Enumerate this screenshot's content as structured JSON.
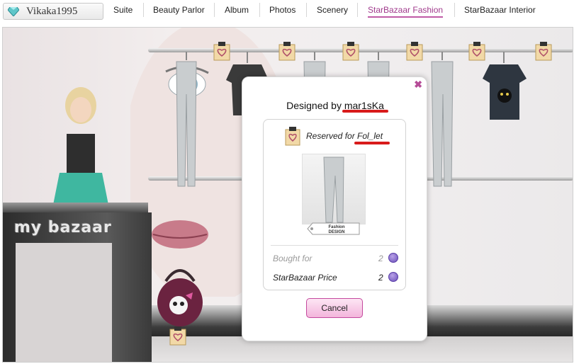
{
  "user": {
    "name": "Vikaka1995"
  },
  "nav": {
    "items": [
      {
        "label": "Suite"
      },
      {
        "label": "Beauty Parlor"
      },
      {
        "label": "Album"
      },
      {
        "label": "Photos"
      },
      {
        "label": "Scenery"
      },
      {
        "label": "StarBazaar Fashion",
        "active": true
      },
      {
        "label": "StarBazaar Interior"
      }
    ]
  },
  "scene": {
    "counter_label": "my bazaar"
  },
  "dialog": {
    "designed_prefix": "Designed by ",
    "designer": "mar1sKa",
    "reserved_prefix": "Reserved for ",
    "reserved_for": "Fol_let",
    "item_tag": "Fashion DESIGN",
    "bought_for_label": "Bought for",
    "bought_for_value": "2",
    "price_label": "StarBazaar Price",
    "price_value": "2",
    "cancel_label": "Cancel",
    "close_glyph": "✖"
  },
  "colors": {
    "accent": "#b54c97",
    "highlight": "#d81b1b",
    "coin": "#6a4fb8"
  },
  "icons": {
    "user_gem": "gem-icon",
    "coin": "coin-icon",
    "tag": "heart-tag-icon"
  }
}
